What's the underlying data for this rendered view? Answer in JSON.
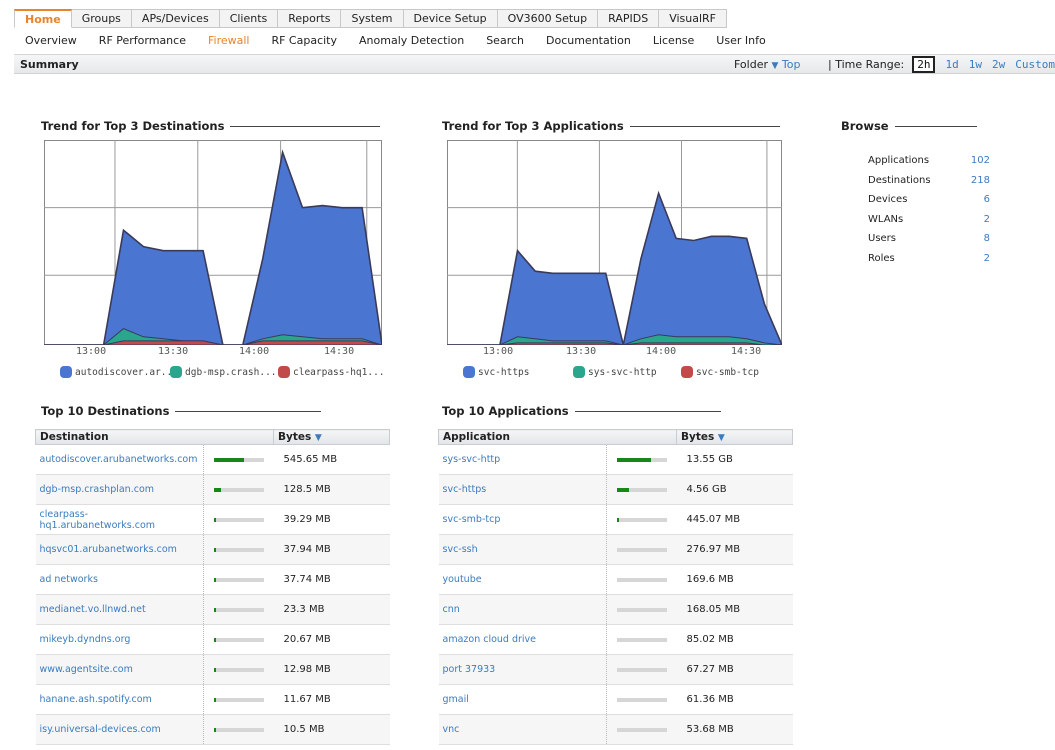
{
  "nav": {
    "tabs": [
      "Home",
      "Groups",
      "APs/Devices",
      "Clients",
      "Reports",
      "System",
      "Device Setup",
      "OV3600 Setup",
      "RAPIDS",
      "VisualRF"
    ],
    "active": 0,
    "subtabs": [
      "Overview",
      "RF Performance",
      "Firewall",
      "RF Capacity",
      "Anomaly Detection",
      "Search",
      "Documentation",
      "License",
      "User Info"
    ],
    "active_sub": 2
  },
  "summary_bar": {
    "title": "Summary",
    "folder_label": "Folder",
    "folder_value": "Top",
    "time_range_label": "| Time Range:",
    "ranges": [
      "2h",
      "1d",
      "1w",
      "2w",
      "Custom"
    ],
    "selected_range": "2h"
  },
  "colors": {
    "accent": "#e8842c",
    "link": "#3b7bbf",
    "bar_fill": "#19861a"
  },
  "chart_data": [
    {
      "type": "area",
      "title": "Trend for Top 3 Destinations",
      "x_ticks": [
        "13:00",
        "13:30",
        "14:00",
        "14:30"
      ],
      "x": [
        0,
        1,
        2,
        3,
        4,
        5,
        6,
        7,
        8,
        9,
        10,
        11,
        12,
        13,
        14,
        15,
        16
      ],
      "ylim": [
        0,
        100
      ],
      "grid": true,
      "legend_position": "bottom",
      "series": [
        {
          "name": "autodiscover.ar...",
          "color": "#4a76d2",
          "values": [
            0,
            0,
            0,
            0,
            56,
            48,
            46,
            46,
            46,
            0,
            0,
            42,
            94,
            67,
            68,
            67,
            67,
            0
          ]
        },
        {
          "name": "dgb-msp.crash...",
          "color": "#2aa58e",
          "values": [
            0,
            0,
            0,
            0,
            8,
            4,
            3,
            2,
            2,
            0,
            0,
            3,
            5,
            4,
            3,
            3,
            3,
            0
          ]
        },
        {
          "name": "clearpass-hq1...",
          "color": "#c34a4a",
          "values": [
            0,
            0,
            0,
            0,
            2,
            2,
            2,
            2,
            2,
            0,
            0,
            2,
            2,
            2,
            2,
            2,
            2,
            0
          ]
        }
      ]
    },
    {
      "type": "area",
      "title": "Trend for Top 3 Applications",
      "x_ticks": [
        "13:00",
        "13:30",
        "14:00",
        "14:30"
      ],
      "ylim": [
        0,
        100
      ],
      "grid": true,
      "legend_position": "bottom",
      "series": [
        {
          "name": "svc-https",
          "color": "#4a76d2",
          "values": [
            0,
            0,
            0,
            0,
            46,
            36,
            35,
            35,
            35,
            35,
            0,
            42,
            74,
            52,
            51,
            53,
            53,
            52,
            20,
            0
          ]
        },
        {
          "name": "sys-svc-http",
          "color": "#2aa58e",
          "values": [
            0,
            0,
            0,
            0,
            4,
            3,
            2,
            2,
            2,
            2,
            0,
            3,
            5,
            4,
            4,
            4,
            4,
            3,
            1,
            0
          ]
        },
        {
          "name": "svc-smb-tcp",
          "color": "#c34a4a",
          "values": [
            0,
            0,
            0,
            0,
            1,
            1,
            1,
            1,
            1,
            1,
            0,
            1,
            1,
            1,
            1,
            1,
            1,
            1,
            0,
            0
          ]
        }
      ]
    }
  ],
  "browse": {
    "title": "Browse",
    "rows": [
      {
        "label": "Applications",
        "value": "102"
      },
      {
        "label": "Destinations",
        "value": "218"
      },
      {
        "label": "Devices",
        "value": "6"
      },
      {
        "label": "WLANs",
        "value": "2"
      },
      {
        "label": "Users",
        "value": "8"
      },
      {
        "label": "Roles",
        "value": "2"
      }
    ]
  },
  "top_destinations": {
    "title": "Top 10 Destinations",
    "col_name": "Destination",
    "col_bytes": "Bytes",
    "rows": [
      {
        "name": "autodiscover.arubanetworks.com",
        "bytes": "545.65 MB",
        "share": 0.6
      },
      {
        "name": "dgb-msp.crashplan.com",
        "bytes": "128.5 MB",
        "share": 0.14
      },
      {
        "name": "clearpass-hq1.arubanetworks.com",
        "bytes": "39.29 MB",
        "share": 0.04
      },
      {
        "name": "hqsvc01.arubanetworks.com",
        "bytes": "37.94 MB",
        "share": 0.04
      },
      {
        "name": "ad networks",
        "bytes": "37.74 MB",
        "share": 0.04
      },
      {
        "name": "medianet.vo.llnwd.net",
        "bytes": "23.3 MB",
        "share": 0.025
      },
      {
        "name": "mikeyb.dyndns.org",
        "bytes": "20.67 MB",
        "share": 0.022
      },
      {
        "name": "www.agentsite.com",
        "bytes": "12.98 MB",
        "share": 0.014
      },
      {
        "name": "hanane.ash.spotify.com",
        "bytes": "11.67 MB",
        "share": 0.012
      },
      {
        "name": "isy.universal-devices.com",
        "bytes": "10.5 MB",
        "share": 0.011
      }
    ]
  },
  "top_applications": {
    "title": "Top 10 Applications",
    "col_name": "Application",
    "col_bytes": "Bytes",
    "rows": [
      {
        "name": "sys-svc-http",
        "bytes": "13.55 GB",
        "share": 0.68
      },
      {
        "name": "svc-https",
        "bytes": "4.56 GB",
        "share": 0.23
      },
      {
        "name": "svc-smb-tcp",
        "bytes": "445.07 MB",
        "share": 0.022
      },
      {
        "name": "svc-ssh",
        "bytes": "276.97 MB",
        "share": 0.0
      },
      {
        "name": "youtube",
        "bytes": "169.6 MB",
        "share": 0.0
      },
      {
        "name": "cnn",
        "bytes": "168.05 MB",
        "share": 0.0
      },
      {
        "name": "amazon cloud drive",
        "bytes": "85.02 MB",
        "share": 0.0
      },
      {
        "name": "port 37933",
        "bytes": "67.27 MB",
        "share": 0.0
      },
      {
        "name": "gmail",
        "bytes": "61.36 MB",
        "share": 0.0
      },
      {
        "name": "vnc",
        "bytes": "53.68 MB",
        "share": 0.0
      }
    ]
  }
}
